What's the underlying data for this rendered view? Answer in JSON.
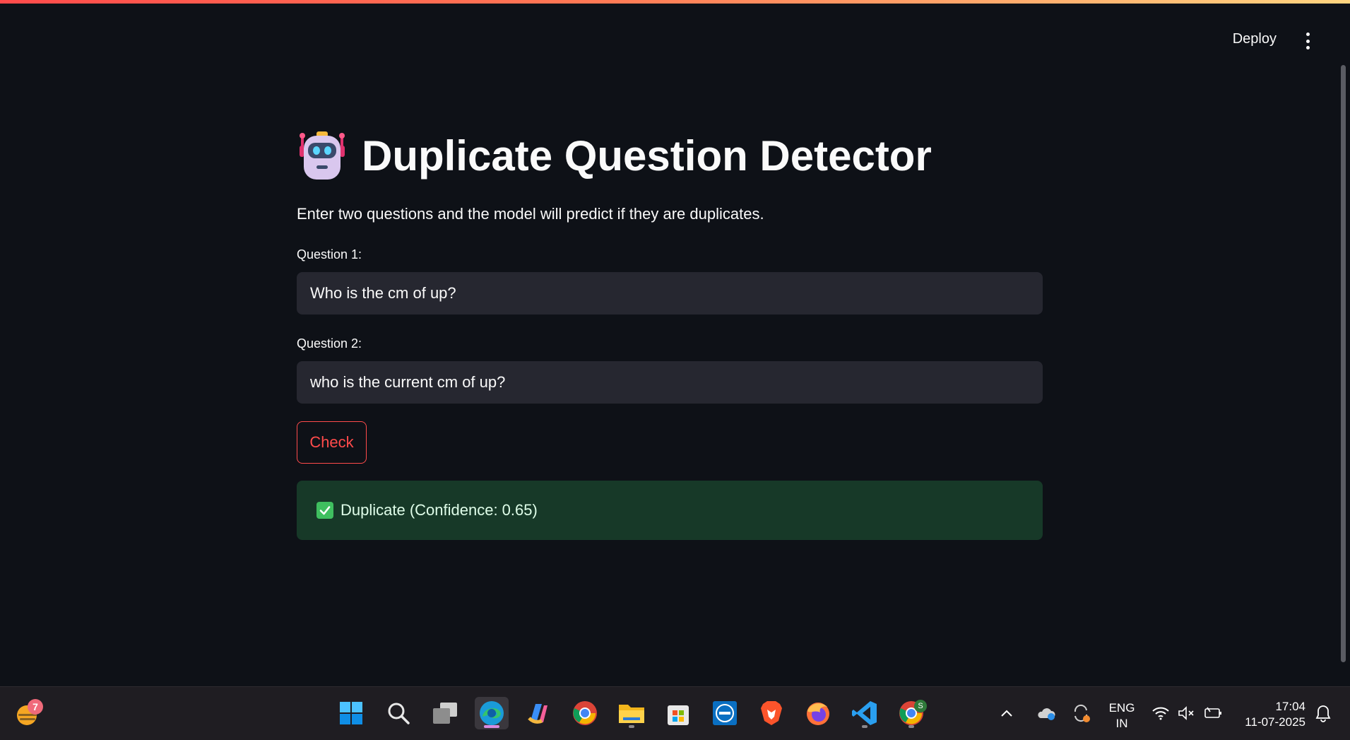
{
  "header": {
    "deploy_label": "Deploy",
    "menu_icon": "vertical-ellipsis-icon"
  },
  "main": {
    "title_icon": "robot-icon",
    "title": "Duplicate Question Detector",
    "subtitle": "Enter two questions and the model will predict if they are duplicates.",
    "question1": {
      "label": "Question 1:",
      "value": "Who is the cm of up?"
    },
    "question2": {
      "label": "Question 2:",
      "value": "who is the current cm of up?"
    },
    "check_label": "Check",
    "result": {
      "icon": "green-check-icon",
      "text": "Duplicate (Confidence: 0.65)"
    }
  },
  "taskbar": {
    "widgets_badge": "7",
    "apps": [
      "start",
      "search",
      "task-view",
      "edge",
      "copilot",
      "chrome",
      "file-explorer",
      "microsoft-store",
      "dell",
      "brave",
      "firefox",
      "vscode",
      "chrome-profile"
    ],
    "profile_badge": "S",
    "language": "ENG",
    "region": "IN",
    "time": "17:04",
    "date": "11-07-2025"
  },
  "colors": {
    "background": "#0e1117",
    "accent": "#ff4b4b",
    "input_bg": "#262730",
    "success_bg": "#173928"
  }
}
